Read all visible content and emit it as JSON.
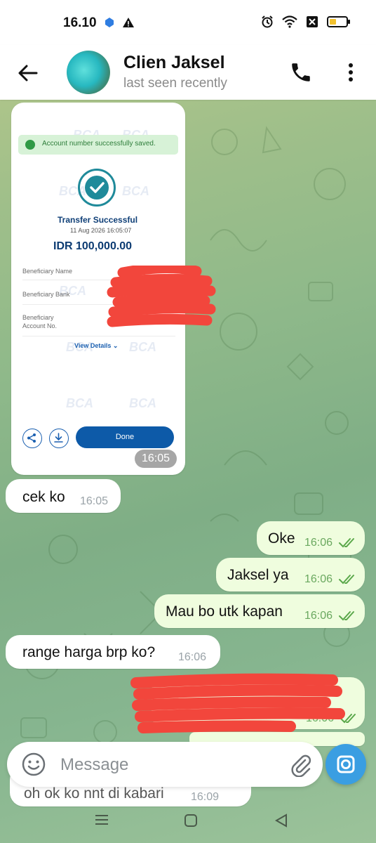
{
  "status_bar": {
    "time": "16.10"
  },
  "header": {
    "name": "Clien Jaksel",
    "status": "last seen recently"
  },
  "image_message": {
    "toast": "Account number successfully saved.",
    "watermark": "BCA",
    "title": "Transfer Successful",
    "datetime": "11 Aug 2026 16:05:07",
    "amount": "IDR 100,000.00",
    "fields": {
      "beneficiary_name": "Beneficiary Name",
      "beneficiary_bank": "Beneficiary Bank",
      "account_line1": "Beneficiary",
      "account_line2": "Account No."
    },
    "view_details": "View Details",
    "done": "Done",
    "time": "16:05"
  },
  "messages": [
    {
      "dir": "in",
      "text": "cek ko",
      "time": "16:05"
    },
    {
      "dir": "out",
      "text": "Oke",
      "time": "16:06"
    },
    {
      "dir": "out",
      "text": "Jaksel ya",
      "time": "16:06"
    },
    {
      "dir": "out",
      "text": "Mau bo utk kapan",
      "time": "16:06"
    },
    {
      "dir": "in",
      "text": "range harga brp ko?",
      "time": "16:06"
    },
    {
      "dir": "out",
      "text": "",
      "time": "16:06"
    },
    {
      "dir": "in",
      "text": "oh ok ko nnt di kabari",
      "time": "16:09"
    }
  ],
  "composer": {
    "placeholder": "Message"
  },
  "icons": {
    "back": "arrow-left-icon",
    "call": "phone-icon",
    "menu": "more-vertical-icon",
    "emoji": "emoji-icon",
    "attach": "paperclip-icon",
    "camera": "camera-icon"
  }
}
